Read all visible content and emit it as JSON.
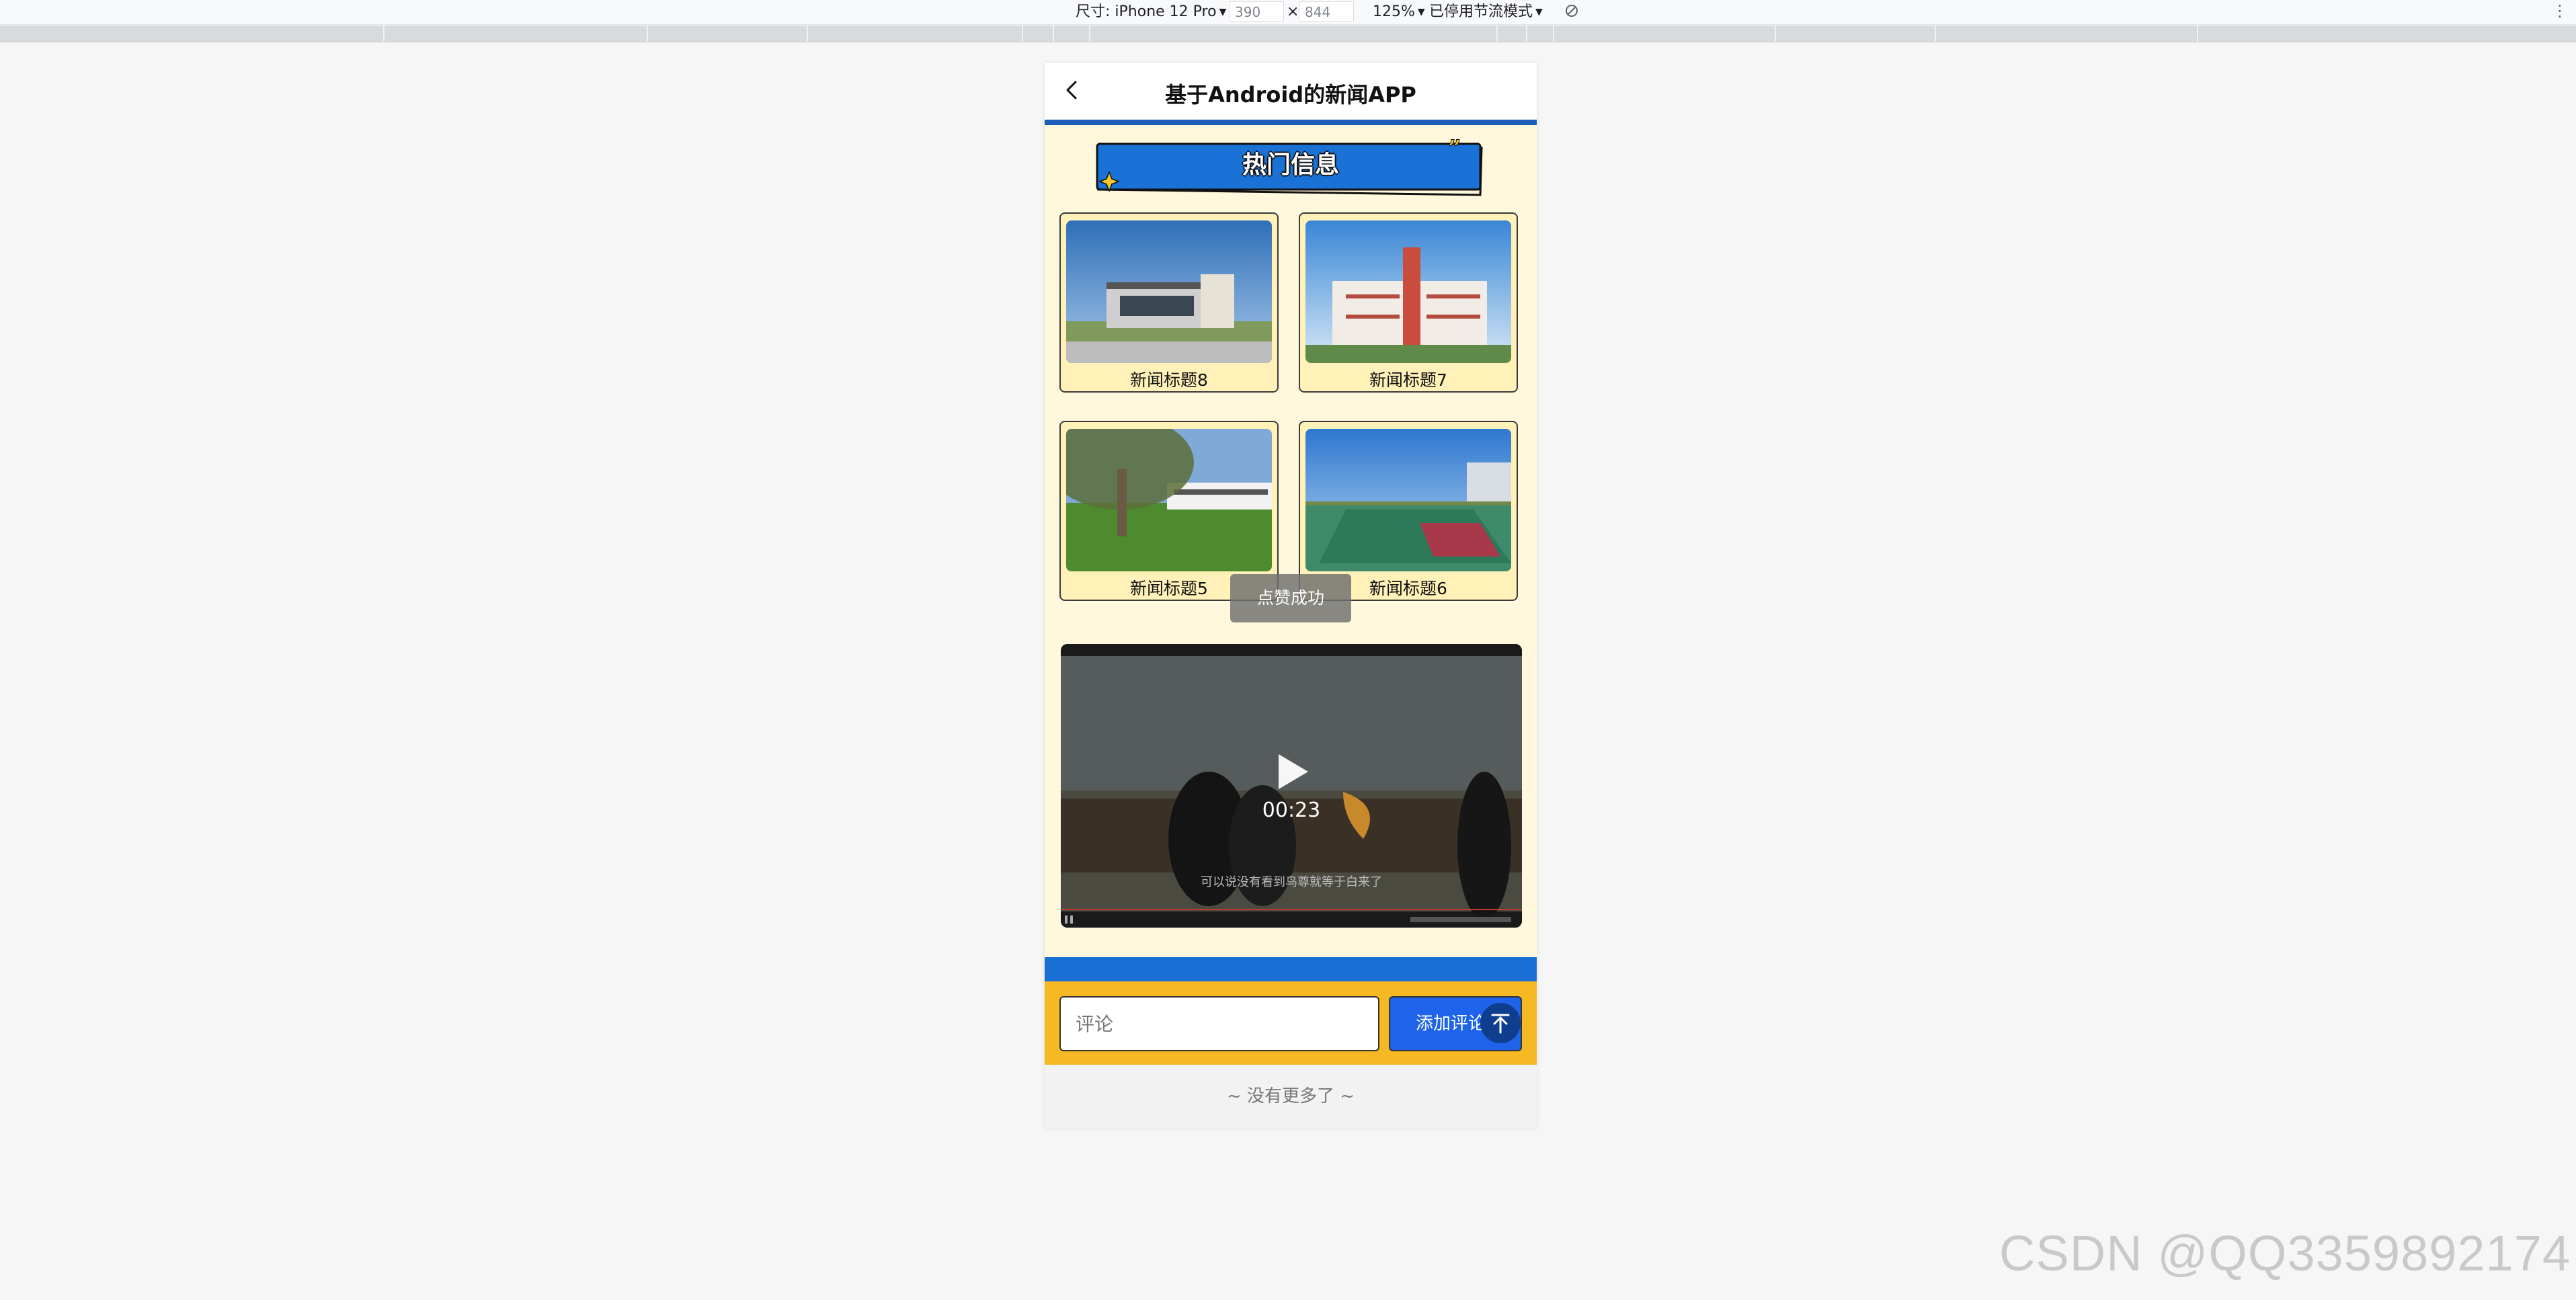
{
  "devtools": {
    "device_label": "尺寸: iPhone 12 Pro",
    "width_value": "390",
    "times": "×",
    "height_value": "844",
    "zoom": "125%",
    "throttle": "已停用节流模式",
    "menu": "⋮"
  },
  "app": {
    "title": "基于Android的新闻APP",
    "banner": "热门信息"
  },
  "news": [
    {
      "title": "新闻标题8",
      "image": "building-modern-photo"
    },
    {
      "title": "新闻标题7",
      "image": "school-tower-photo"
    },
    {
      "title": "新闻标题5",
      "image": "campus-tree-photo"
    },
    {
      "title": "新闻标题6",
      "image": "sports-courts-photo"
    }
  ],
  "toast": "点赞成功",
  "video": {
    "duration": "00:23",
    "subtitle": "可以说没有看到鸟尊就等于白来了"
  },
  "comment": {
    "placeholder": "评论",
    "button": "添加评论"
  },
  "footer": "~ 没有更多了 ~",
  "watermark": "CSDN @QQ3359892174",
  "colors": {
    "nav_line": "#1b5fb8",
    "page_bg": "#fff8dc",
    "comment_bar": "#f6b823",
    "accent_blue": "#1e63e9"
  }
}
